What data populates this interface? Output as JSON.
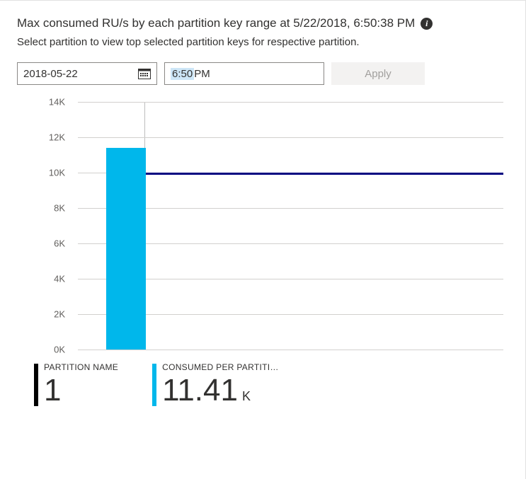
{
  "title": "Max consumed RU/s by each partition key range at 5/22/2018, 6:50:38 PM",
  "subtitle": "Select partition to view top selected partition keys for respective partition.",
  "controls": {
    "date_value": "2018-05-22",
    "time_hour": "6:50",
    "time_ampm": " PM",
    "apply_label": "Apply"
  },
  "chart_data": {
    "type": "bar",
    "categories": [
      "1"
    ],
    "values": [
      11410
    ],
    "threshold_value": 10000,
    "threshold_color": "#000080",
    "bar_color": "#00b7eb",
    "ylabel": "",
    "ylim": [
      0,
      14000
    ],
    "y_ticks": [
      0,
      2000,
      4000,
      6000,
      8000,
      10000,
      12000,
      14000
    ],
    "y_tick_labels": [
      "0K",
      "2K",
      "4K",
      "6K",
      "8K",
      "10K",
      "12K",
      "14K"
    ]
  },
  "metrics": {
    "partition_name_label": "PARTITION NAME",
    "partition_name_value": "1",
    "consumed_label": "CONSUMED PER PARTITI…",
    "consumed_value": "11.41",
    "consumed_unit": "K"
  }
}
